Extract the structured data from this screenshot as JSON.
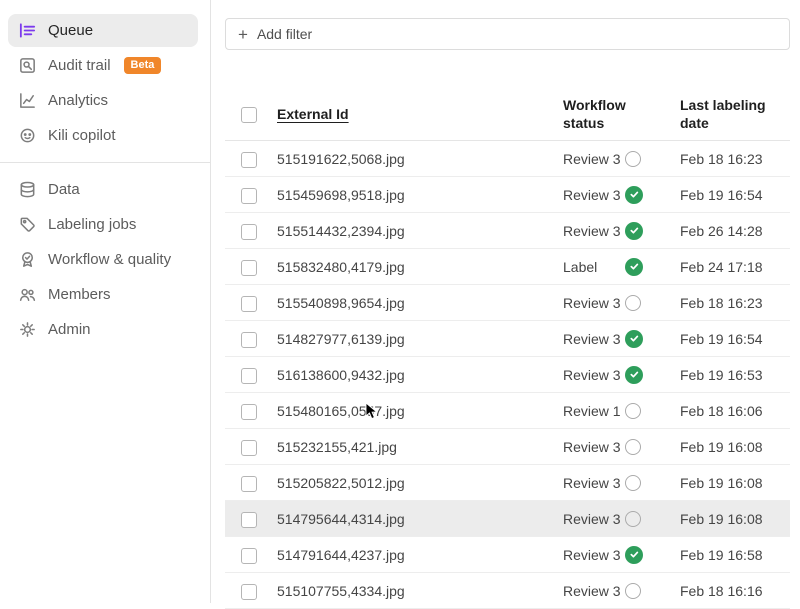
{
  "colors": {
    "accent": "#7C3AED",
    "badge": "#F0862A",
    "done_green": "#2E9E5B",
    "row_highlight": "#ECECEC"
  },
  "sidebar": {
    "items": [
      {
        "label": "Queue",
        "icon": "queue-icon",
        "active": true
      },
      {
        "label": "Audit trail",
        "icon": "audit-trail-icon",
        "badge": "Beta"
      },
      {
        "label": "Analytics",
        "icon": "analytics-icon"
      },
      {
        "label": "Kili copilot",
        "icon": "copilot-icon"
      },
      {
        "label": "Data",
        "icon": "data-icon"
      },
      {
        "label": "Labeling jobs",
        "icon": "tag-icon"
      },
      {
        "label": "Workflow & quality",
        "icon": "quality-check-icon"
      },
      {
        "label": "Members",
        "icon": "members-icon"
      },
      {
        "label": "Admin",
        "icon": "gear-icon"
      }
    ]
  },
  "toolbar": {
    "add_filter_label": "Add filter"
  },
  "table": {
    "headers": {
      "external_id": "External Id",
      "workflow_status": "Workflow status",
      "last_labeling_date": "Last labeling date"
    },
    "rows": [
      {
        "external_id": "515191622,5068.jpg",
        "workflow_status": "Review 3",
        "done": false,
        "date": "Feb 18 16:23",
        "highlighted": false
      },
      {
        "external_id": "515459698,9518.jpg",
        "workflow_status": "Review 3",
        "done": true,
        "date": "Feb 19 16:54",
        "highlighted": false
      },
      {
        "external_id": "515514432,2394.jpg",
        "workflow_status": "Review 3",
        "done": true,
        "date": "Feb 26 14:28",
        "highlighted": false
      },
      {
        "external_id": "515832480,4179.jpg",
        "workflow_status": "Label",
        "done": true,
        "date": "Feb 24 17:18",
        "highlighted": false
      },
      {
        "external_id": "515540898,9654.jpg",
        "workflow_status": "Review 3",
        "done": false,
        "date": "Feb 18 16:23",
        "highlighted": false
      },
      {
        "external_id": "514827977,6139.jpg",
        "workflow_status": "Review 3",
        "done": true,
        "date": "Feb 19 16:54",
        "highlighted": false
      },
      {
        "external_id": "516138600,9432.jpg",
        "workflow_status": "Review 3",
        "done": true,
        "date": "Feb 19 16:53",
        "highlighted": false
      },
      {
        "external_id": "515480165,0557.jpg",
        "workflow_status": "Review 1",
        "done": false,
        "date": "Feb 18 16:06",
        "highlighted": false
      },
      {
        "external_id": "515232155,421.jpg",
        "workflow_status": "Review 3",
        "done": false,
        "date": "Feb 19 16:08",
        "highlighted": false
      },
      {
        "external_id": "515205822,5012.jpg",
        "workflow_status": "Review 3",
        "done": false,
        "date": "Feb 19 16:08",
        "highlighted": false
      },
      {
        "external_id": "514795644,4314.jpg",
        "workflow_status": "Review 3",
        "done": false,
        "date": "Feb 19 16:08",
        "highlighted": true
      },
      {
        "external_id": "514791644,4237.jpg",
        "workflow_status": "Review 3",
        "done": true,
        "date": "Feb 19 16:58",
        "highlighted": false
      },
      {
        "external_id": "515107755,4334.jpg",
        "workflow_status": "Review 3",
        "done": false,
        "date": "Feb 18 16:16",
        "highlighted": false
      }
    ]
  }
}
